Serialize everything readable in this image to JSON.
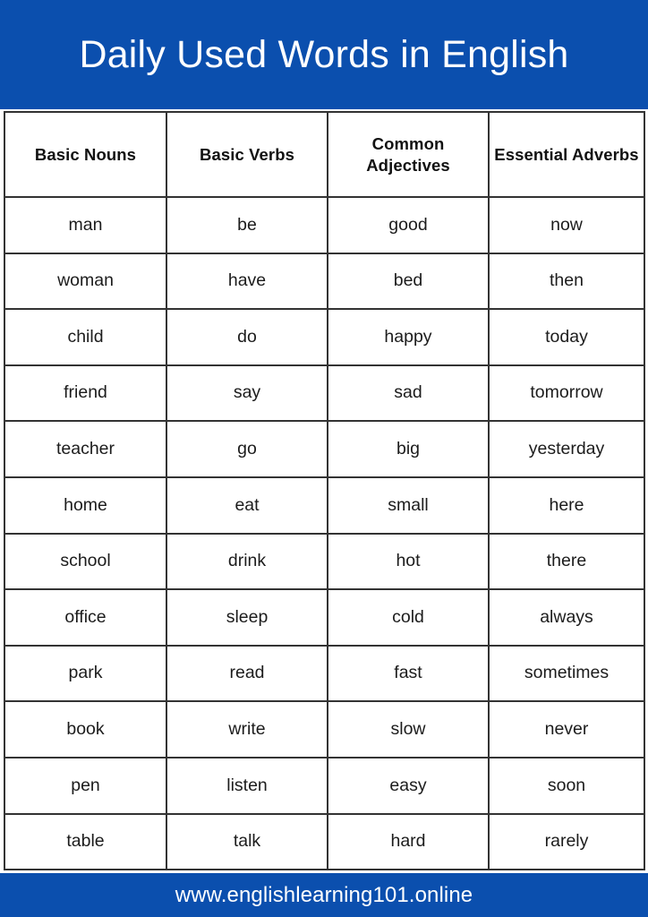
{
  "header": {
    "title": "Daily Used Words in English",
    "background_color": "#0b4fae",
    "text_color": "#ffffff"
  },
  "footer": {
    "url": "www.englishlearning101.online",
    "background_color": "#0b4fae",
    "text_color": "#ffffff"
  },
  "table": {
    "border_color": "#333333",
    "background_color": "#ffffff",
    "text_color": "#1c1c1c",
    "columns": [
      "Basic Nouns",
      "Basic Verbs",
      "Common Adjectives",
      "Essential Adverbs"
    ],
    "rows": [
      [
        "man",
        "be",
        "good",
        "now"
      ],
      [
        "woman",
        "have",
        "bed",
        "then"
      ],
      [
        "child",
        "do",
        "happy",
        "today"
      ],
      [
        "friend",
        "say",
        "sad",
        "tomorrow"
      ],
      [
        "teacher",
        "go",
        "big",
        "yesterday"
      ],
      [
        "home",
        "eat",
        "small",
        "here"
      ],
      [
        "school",
        "drink",
        "hot",
        "there"
      ],
      [
        "office",
        "sleep",
        "cold",
        "always"
      ],
      [
        "park",
        "read",
        "fast",
        "sometimes"
      ],
      [
        "book",
        "write",
        "slow",
        "never"
      ],
      [
        "pen",
        "listen",
        "easy",
        "soon"
      ],
      [
        "table",
        "talk",
        "hard",
        "rarely"
      ]
    ]
  }
}
